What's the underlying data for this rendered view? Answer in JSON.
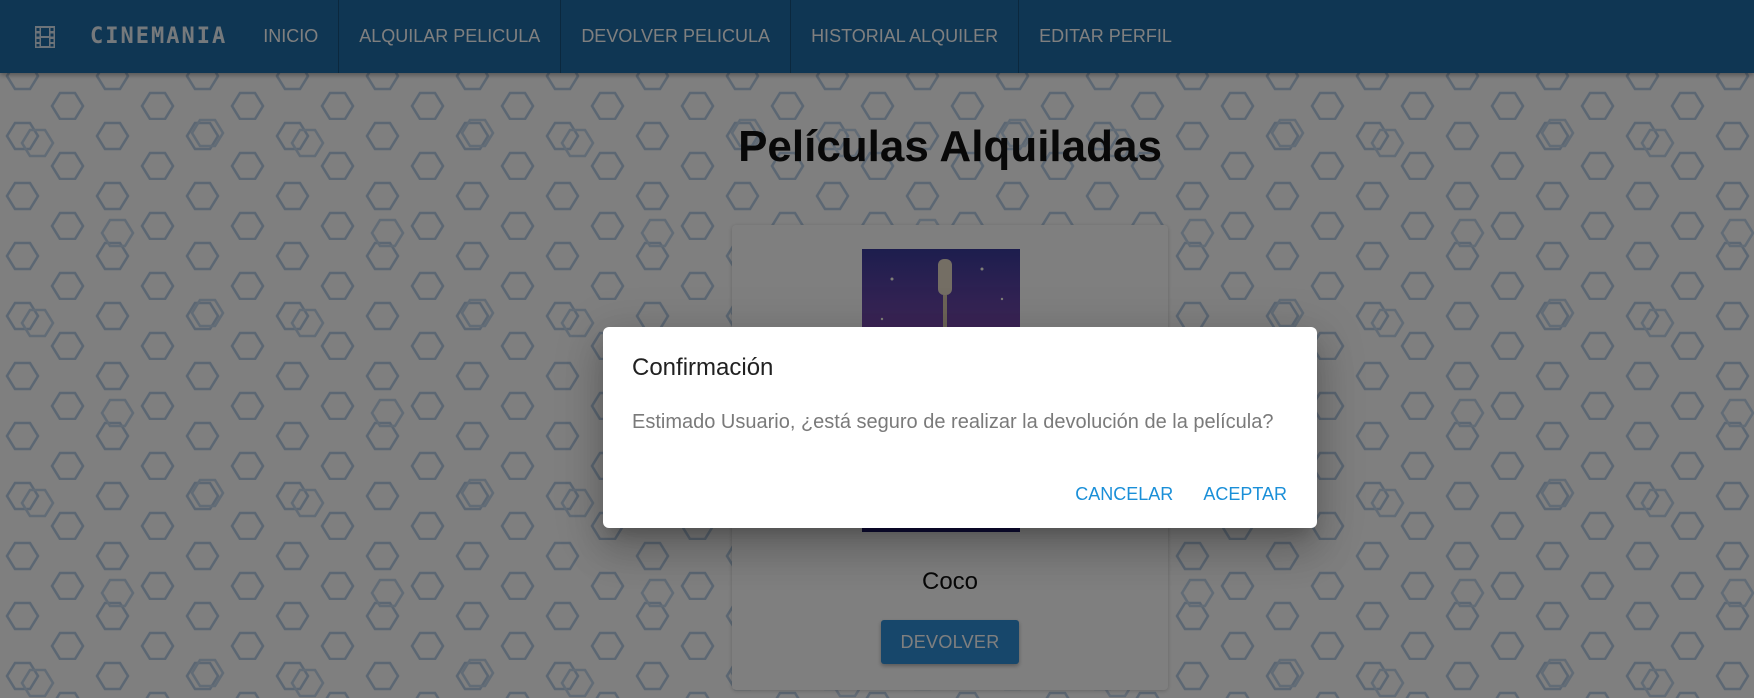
{
  "navbar": {
    "brand_icon": "film-icon",
    "brand_name": "CINEMANIA",
    "items": [
      {
        "label": "INICIO"
      },
      {
        "label": "ALQUILAR PELICULA"
      },
      {
        "label": "DEVOLVER PELICULA"
      },
      {
        "label": "HISTORIAL ALQUILER"
      },
      {
        "label": "EDITAR PERFIL"
      }
    ]
  },
  "main": {
    "title": "Películas Alquiladas",
    "movies": [
      {
        "title": "Coco",
        "return_label": "DEVOLVER",
        "poster_icon": "coco-poster-image"
      }
    ]
  },
  "dialog": {
    "title": "Confirmación",
    "message": "Estimado Usuario, ¿está seguro de realizar la devolución de la película?",
    "cancel_label": "CANCELAR",
    "accept_label": "ACEPTAR"
  },
  "colors": {
    "navbar": "#1f6da6",
    "primary_button": "#2f8fd6",
    "dialog_action": "#1a8fd8",
    "overlay": "rgba(0,0,0,0.5)"
  }
}
